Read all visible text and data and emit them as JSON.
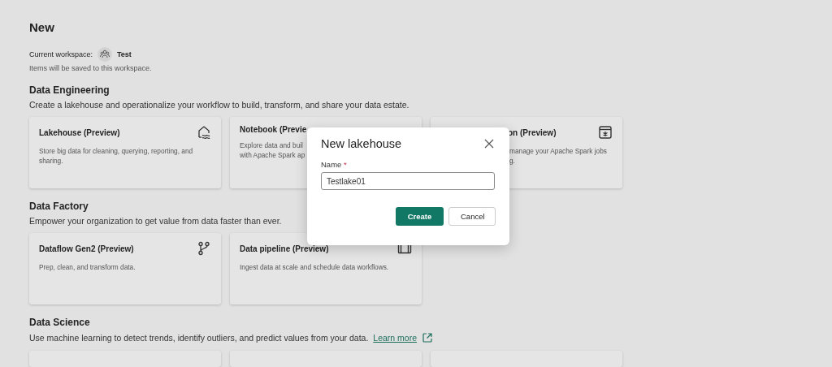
{
  "page": {
    "title": "New",
    "workspace_label": "Current workspace:",
    "workspace_name": "Test",
    "workspace_note": "Items will be saved to this workspace."
  },
  "sections": [
    {
      "title": "Data Engineering",
      "description": "Create a lakehouse and operationalize your workflow to build, transform, and share your data estate.",
      "cards": [
        {
          "title": "Lakehouse (Preview)",
          "kind": "lakehouse",
          "description_lines": [
            "Store big data for cleaning, querying, reporting, and",
            "sharing."
          ]
        },
        {
          "title": "Notebook (Previe",
          "kind": "notebook",
          "description_lines": [
            "Explore data and buil",
            "with Apache Spark ap"
          ]
        },
        {
          "title": "on (Preview)",
          "kind": "spark-job",
          "description_lines": [
            "manage your Apache Spark jobs",
            "g."
          ]
        }
      ]
    },
    {
      "title": "Data Factory",
      "description": "Empower your organization to get value from data faster than ever.",
      "cards": [
        {
          "title": "Dataflow Gen2 (Preview)",
          "kind": "dataflow",
          "description_lines": [
            "Prep, clean, and transform data."
          ]
        },
        {
          "title": "Data pipeline (Preview)",
          "kind": "pipeline",
          "description_lines": [
            "Ingest data at scale and schedule data workflows."
          ]
        }
      ]
    },
    {
      "title": "Data Science",
      "description": "Use machine learning to detect trends, identify outliers, and predict values from your data.",
      "link": "Learn more",
      "cards": [
        {
          "kind": "cut"
        },
        {
          "kind": "cut"
        },
        {
          "kind": "cut"
        }
      ]
    }
  ],
  "dialog": {
    "title": "New lakehouse",
    "field_label": "Name",
    "required_mark": "*",
    "field_value": "Testlake01",
    "buttons": [
      {
        "label": "Create",
        "kind": "primary"
      },
      {
        "label": "Cancel",
        "kind": "secondary"
      }
    ]
  }
}
